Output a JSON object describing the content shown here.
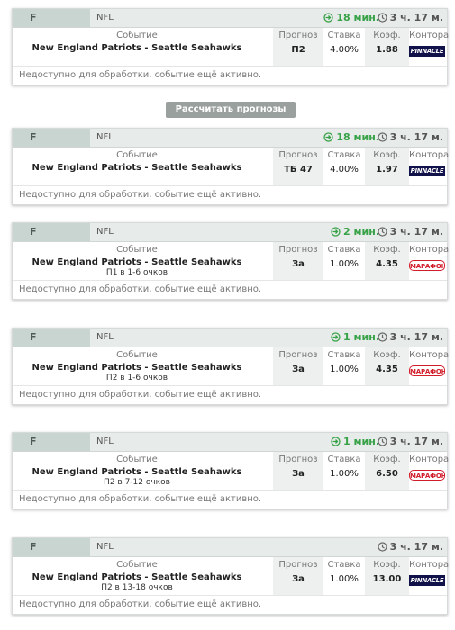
{
  "labels": {
    "event": "Событие",
    "prediction": "Прогноз",
    "stake": "Ставка",
    "coef": "Коэф.",
    "bookmaker": "Контора",
    "unavailable": "Недоступно для обработки, событие ещё активно."
  },
  "calc_button": "Рассчитать прогнозы",
  "colors": {
    "timer": "#37a247",
    "header_bg": "#e7ebea",
    "sport_bg": "#c9d5d1",
    "button_bg": "#9aa09e",
    "pinnacle": "#11124a",
    "marathon": "#d21d2b"
  },
  "cards": [
    {
      "sport": "F",
      "league": "NFL",
      "timer": "18 мин.",
      "time_left": "3 ч. 17 м.",
      "event": "New England Patriots - Seattle Seahawks",
      "sub": "",
      "prediction": "П2",
      "stake": "4.00%",
      "coef": "1.88",
      "bookmaker": "PINNACLE",
      "bookmaker_icon": "pinnacle-logo"
    },
    {
      "sport": "F",
      "league": "NFL",
      "timer": "18 мин.",
      "time_left": "3 ч. 17 м.",
      "event": "New England Patriots - Seattle Seahawks",
      "sub": "",
      "prediction": "ТБ 47",
      "stake": "4.00%",
      "coef": "1.97",
      "bookmaker": "PINNACLE",
      "bookmaker_icon": "pinnacle-logo"
    },
    {
      "sport": "F",
      "league": "NFL",
      "timer": "2 мин.",
      "time_left": "3 ч. 17 м.",
      "event": "New England Patriots - Seattle Seahawks",
      "sub": "П1 в 1-6 очков",
      "prediction": "За",
      "stake": "1.00%",
      "coef": "4.35",
      "bookmaker": "МАРАФОН",
      "bookmaker_icon": "marathon-logo"
    },
    {
      "sport": "F",
      "league": "NFL",
      "timer": "1 мин.",
      "time_left": "3 ч. 17 м.",
      "event": "New England Patriots - Seattle Seahawks",
      "sub": "П2 в 1-6 очков",
      "prediction": "За",
      "stake": "1.00%",
      "coef": "4.35",
      "bookmaker": "МАРАФОН",
      "bookmaker_icon": "marathon-logo"
    },
    {
      "sport": "F",
      "league": "NFL",
      "timer": "1 мин.",
      "time_left": "3 ч. 17 м.",
      "event": "New England Patriots - Seattle Seahawks",
      "sub": "П2 в 7-12 очков",
      "prediction": "За",
      "stake": "1.00%",
      "coef": "6.50",
      "bookmaker": "МАРАФОН",
      "bookmaker_icon": "marathon-logo"
    },
    {
      "sport": "F",
      "league": "NFL",
      "timer": "",
      "time_left": "3 ч. 17 м.",
      "event": "New England Patriots - Seattle Seahawks",
      "sub": "П2 в 13-18 очков",
      "prediction": "За",
      "stake": "1.00%",
      "coef": "13.00",
      "bookmaker": "PINNACLE",
      "bookmaker_icon": "pinnacle-logo"
    }
  ]
}
